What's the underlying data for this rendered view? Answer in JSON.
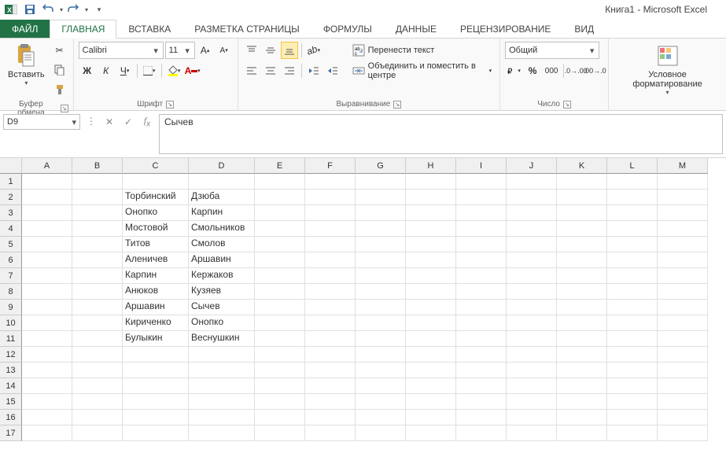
{
  "title": "Книга1 - Microsoft Excel",
  "tabs": {
    "file": "ФАЙЛ",
    "home": "ГЛАВНАЯ",
    "insert": "ВСТАВКА",
    "layout": "РАЗМЕТКА СТРАНИЦЫ",
    "formulas": "ФОРМУЛЫ",
    "data": "ДАННЫЕ",
    "review": "РЕЦЕНЗИРОВАНИЕ",
    "view": "ВИД"
  },
  "ribbon": {
    "clipboard": {
      "paste": "Вставить",
      "label": "Буфер обмена"
    },
    "font": {
      "name": "Calibri",
      "size": "11",
      "bold": "Ж",
      "italic": "К",
      "underline": "Ч",
      "label": "Шрифт"
    },
    "alignment": {
      "wrap": "Перенести текст",
      "merge": "Объединить и поместить в центре",
      "label": "Выравнивание"
    },
    "number": {
      "format": "Общий",
      "label": "Число"
    },
    "styles": {
      "condfmt": "Условное форматирование"
    }
  },
  "formula_bar": {
    "cell_ref": "D9",
    "value": "Сычев"
  },
  "columns": [
    "A",
    "B",
    "C",
    "D",
    "E",
    "F",
    "G",
    "H",
    "I",
    "J",
    "K",
    "L",
    "M"
  ],
  "row_count": 17,
  "cells": {
    "C2": "Торбинский",
    "D2": "Дзюба",
    "C3": "Онопко",
    "D3": "Карпин",
    "C4": "Мостовой",
    "D4": "Смольников",
    "C5": "Титов",
    "D5": "Смолов",
    "C6": "Аленичев",
    "D6": "Аршавин",
    "C7": "Карпин",
    "D7": "Кержаков",
    "C8": "Анюков",
    "D8": "Кузяев",
    "C9": "Аршавин",
    "D9": "Сычев",
    "C10": "Кириченко",
    "D10": "Онопко",
    "C11": "Булыкин",
    "D11": "Веснушкин"
  }
}
